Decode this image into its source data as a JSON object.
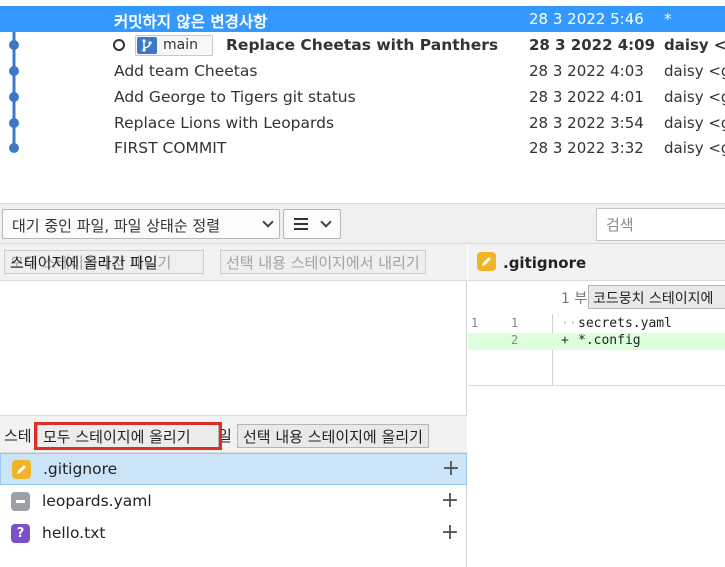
{
  "history": {
    "rows": [
      {
        "message": "커밋하지 않은 변경사항",
        "date": "28 3 2022 5:46",
        "author": "*"
      },
      {
        "branch": "main",
        "message": "Replace Cheetas with Panthers",
        "date": "28 3 2022 4:09",
        "author": "daisy <g"
      },
      {
        "message": "Add team Cheetas",
        "date": "28 3 2022 4:03",
        "author": "daisy <g"
      },
      {
        "message": "Add George to Tigers git status",
        "date": "28 3 2022 4:01",
        "author": "daisy <g"
      },
      {
        "message": "Replace Lions with Leopards",
        "date": "28 3 2022 3:54",
        "author": "daisy <g"
      },
      {
        "message": "FIRST COMMIT",
        "date": "28 3 2022 3:32",
        "author": "daisy <g"
      }
    ]
  },
  "toolbar": {
    "sort_label": "대기 중인 파일, 파일 상태순 정렬",
    "search_placeholder": "검색"
  },
  "unstaged": {
    "title_overlap": "스테이지에 올라간 파일",
    "unstage_all_partial": "모두 스테이지에서 내리기",
    "unstage_selected": "선택 내용 스테이지에서 내리기"
  },
  "staged": {
    "title_left": "스테",
    "title_right": "일",
    "stage_all": "모두 스테이지에 올리기",
    "stage_selected": "선택 내용 스테이지에 올리기",
    "files": [
      {
        "name": ".gitignore",
        "status": "modified",
        "color": "#f0b429",
        "selected": true
      },
      {
        "name": "leopards.yaml",
        "status": "removed",
        "color": "#9aa0a6",
        "selected": false
      },
      {
        "name": "hello.txt",
        "status": "untracked",
        "color": "#7b4fc9",
        "selected": false
      }
    ]
  },
  "diff": {
    "filename": ".gitignore",
    "hunk_label": "1 부",
    "hunk_button": "코드뭉치 스테이지에",
    "lines": [
      {
        "old": "1",
        "new": "1",
        "sign": "···",
        "code": "secrets.yaml",
        "type": "context"
      },
      {
        "old": "",
        "new": "2",
        "sign": "+",
        "code": "*.config",
        "type": "added"
      }
    ]
  },
  "colors": {
    "selection": "#3399ff",
    "graph": "#3c78c8",
    "highlight": "#d9302a",
    "added_bg": "#ddffdd"
  }
}
